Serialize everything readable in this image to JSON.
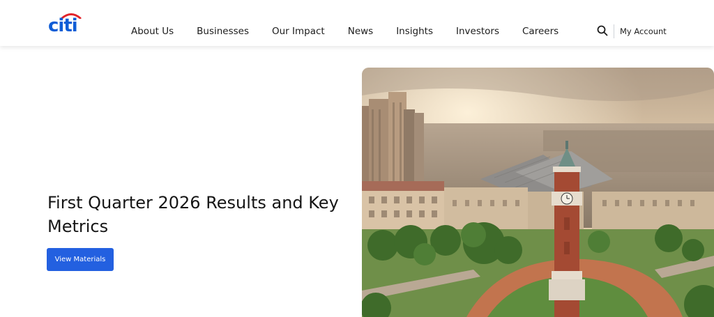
{
  "brand": {
    "logo_text": "citi",
    "logo_arc_color": "#e2232a",
    "primary_color": "#0f5dd6"
  },
  "nav": {
    "items": [
      {
        "label": "About Us"
      },
      {
        "label": "Businesses"
      },
      {
        "label": "Our Impact"
      },
      {
        "label": "News"
      },
      {
        "label": "Insights"
      },
      {
        "label": "Investors"
      },
      {
        "label": "Careers"
      }
    ],
    "search_icon": "search-icon",
    "account_label": "My Account"
  },
  "hero": {
    "title": "First Quarter 2026 Results and Key Metrics",
    "cta_label": "View Materials",
    "cta_color": "#2360e0",
    "image_subject": "clock-tower-city-aerial"
  }
}
